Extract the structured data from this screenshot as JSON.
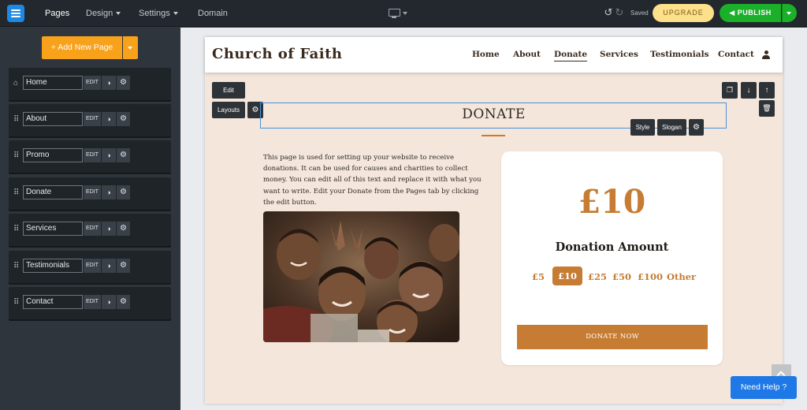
{
  "topbar": {
    "nav": [
      {
        "label": "Pages",
        "active": true
      },
      {
        "label": "Design",
        "active": false
      },
      {
        "label": "Settings",
        "active": false
      },
      {
        "label": "Domain",
        "active": false
      }
    ],
    "saved_label": "Saved",
    "upgrade_label": "UPGRADE",
    "publish_label": "PUBLISH",
    "icons": [
      "logo-icon",
      "desktop-icon",
      "undo-icon",
      "redo-icon",
      "megaphone-icon"
    ]
  },
  "sidebar": {
    "add_page_label": "+ Add New Page",
    "pages": [
      {
        "name": "Home",
        "edit": "EDIT",
        "icon": "home-icon"
      },
      {
        "name": "About",
        "edit": "EDIT",
        "icon": "drag-handle-icon"
      },
      {
        "name": "Promo",
        "edit": "EDIT",
        "icon": "drag-handle-icon"
      },
      {
        "name": "Donate",
        "edit": "EDIT",
        "icon": "drag-handle-icon"
      },
      {
        "name": "Services",
        "edit": "EDIT",
        "icon": "drag-handle-icon"
      },
      {
        "name": "Testimonials",
        "edit": "EDIT",
        "icon": "drag-handle-icon"
      },
      {
        "name": "Contact",
        "edit": "EDIT",
        "icon": "drag-handle-icon"
      }
    ]
  },
  "site": {
    "title": "Church of Faith",
    "nav": [
      "Home",
      "About",
      "Donate",
      "Services",
      "Testimonials",
      "Contact"
    ],
    "active_nav": "Donate"
  },
  "editor": {
    "edit_label": "Edit",
    "layouts_label": "Layouts",
    "style_label": "Style",
    "slogan_label": "Slogan"
  },
  "section": {
    "title": "DONATE",
    "body": "This page is used for setting up your website to receive donations. It can be used for causes and charities to collect money. You can edit all of this text and replace it with what you want to write. Edit your Donate from the Pages tab by clicking the edit button."
  },
  "donation": {
    "selected_amount": "£10",
    "label": "Donation Amount",
    "options": [
      "£5",
      "£10",
      "£25",
      "£50",
      "£100",
      "Other"
    ],
    "selected_option": "£10",
    "button_label": "DONATE NOW"
  },
  "help_label": "Need Help ?",
  "colors": {
    "accent": "#c67c33",
    "publish": "#1bb02a",
    "upgrade": "#fde08a",
    "add_page": "#f8a11a",
    "help": "#1e78e6",
    "site_bg": "#f4e6db"
  }
}
